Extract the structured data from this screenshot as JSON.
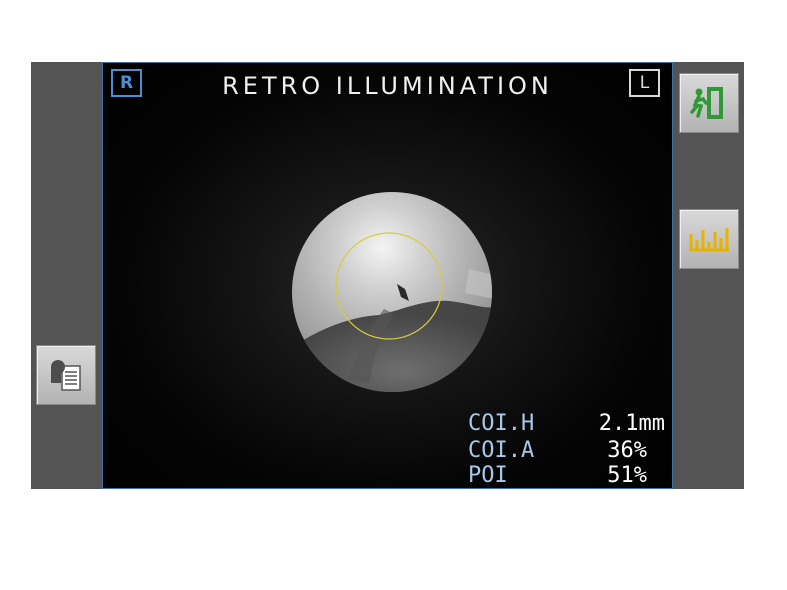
{
  "screen": {
    "mode_title": "RETRO ILLUMINATION",
    "eye_right_badge": "R",
    "eye_left_badge": "L"
  },
  "readouts": [
    {
      "label": "COI.H",
      "value": "2.1mm"
    },
    {
      "label": "COI.A",
      "value": "36%"
    },
    {
      "label": "POI",
      "value": "51%"
    }
  ],
  "buttons": {
    "exit_icon": "exit-door-icon",
    "graph_icon": "bar-graph-icon",
    "print_icon": "print-report-icon"
  },
  "colors": {
    "device_bezel": "#545454",
    "screen_border": "#3f6fa6",
    "right_eye_badge": "#4a8fd0",
    "label_text": "#a9c8e8",
    "analysis_circle": "#d6cc3a",
    "exit_icon_green": "#2f9a35",
    "graph_icon_yellow": "#e6b400"
  }
}
